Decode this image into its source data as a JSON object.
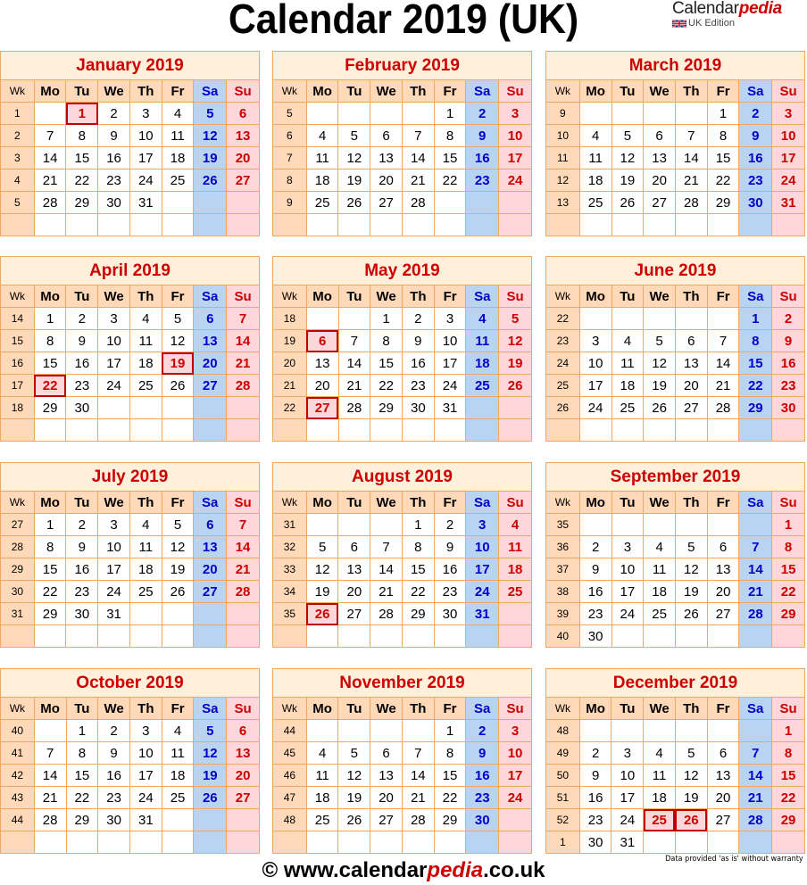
{
  "header": {
    "title": "Calendar 2019 (UK)",
    "brand": {
      "name_plain": "Calendar",
      "name_accent": "pedia",
      "edition": "UK Edition",
      "flag_icon": "uk-flag-icon"
    }
  },
  "colors": {
    "border": "#f0a860",
    "title_bg": "#fff0dc",
    "header_bg": "#ffd9b8",
    "saturday_bg": "#b8d4f0",
    "saturday_text": "#0000cc",
    "sunday_bg": "#ffd6d9",
    "sunday_text": "#cc0000",
    "holiday_border": "#c00000",
    "month_title": "#cc0000"
  },
  "weekday_headers": [
    "Wk",
    "Mo",
    "Tu",
    "We",
    "Th",
    "Fr",
    "Sa",
    "Su"
  ],
  "months": [
    {
      "name": "January 2019",
      "rows": [
        {
          "wk": "1",
          "days": [
            "",
            "1",
            "2",
            "3",
            "4",
            "5",
            "6"
          ]
        },
        {
          "wk": "2",
          "days": [
            "7",
            "8",
            "9",
            "10",
            "11",
            "12",
            "13"
          ]
        },
        {
          "wk": "3",
          "days": [
            "14",
            "15",
            "16",
            "17",
            "18",
            "19",
            "20"
          ]
        },
        {
          "wk": "4",
          "days": [
            "21",
            "22",
            "23",
            "24",
            "25",
            "26",
            "27"
          ]
        },
        {
          "wk": "5",
          "days": [
            "28",
            "29",
            "30",
            "31",
            "",
            "",
            ""
          ]
        },
        {
          "wk": "",
          "days": [
            "",
            "",
            "",
            "",
            "",
            "",
            ""
          ]
        }
      ],
      "holidays": [
        "1"
      ]
    },
    {
      "name": "February 2019",
      "rows": [
        {
          "wk": "5",
          "days": [
            "",
            "",
            "",
            "",
            "1",
            "2",
            "3"
          ]
        },
        {
          "wk": "6",
          "days": [
            "4",
            "5",
            "6",
            "7",
            "8",
            "9",
            "10"
          ]
        },
        {
          "wk": "7",
          "days": [
            "11",
            "12",
            "13",
            "14",
            "15",
            "16",
            "17"
          ]
        },
        {
          "wk": "8",
          "days": [
            "18",
            "19",
            "20",
            "21",
            "22",
            "23",
            "24"
          ]
        },
        {
          "wk": "9",
          "days": [
            "25",
            "26",
            "27",
            "28",
            "",
            "",
            ""
          ]
        },
        {
          "wk": "",
          "days": [
            "",
            "",
            "",
            "",
            "",
            "",
            ""
          ]
        }
      ],
      "holidays": []
    },
    {
      "name": "March 2019",
      "rows": [
        {
          "wk": "9",
          "days": [
            "",
            "",
            "",
            "",
            "1",
            "2",
            "3"
          ]
        },
        {
          "wk": "10",
          "days": [
            "4",
            "5",
            "6",
            "7",
            "8",
            "9",
            "10"
          ]
        },
        {
          "wk": "11",
          "days": [
            "11",
            "12",
            "13",
            "14",
            "15",
            "16",
            "17"
          ]
        },
        {
          "wk": "12",
          "days": [
            "18",
            "19",
            "20",
            "21",
            "22",
            "23",
            "24"
          ]
        },
        {
          "wk": "13",
          "days": [
            "25",
            "26",
            "27",
            "28",
            "29",
            "30",
            "31"
          ]
        },
        {
          "wk": "",
          "days": [
            "",
            "",
            "",
            "",
            "",
            "",
            ""
          ]
        }
      ],
      "holidays": []
    },
    {
      "name": "April 2019",
      "rows": [
        {
          "wk": "14",
          "days": [
            "1",
            "2",
            "3",
            "4",
            "5",
            "6",
            "7"
          ]
        },
        {
          "wk": "15",
          "days": [
            "8",
            "9",
            "10",
            "11",
            "12",
            "13",
            "14"
          ]
        },
        {
          "wk": "16",
          "days": [
            "15",
            "16",
            "17",
            "18",
            "19",
            "20",
            "21"
          ]
        },
        {
          "wk": "17",
          "days": [
            "22",
            "23",
            "24",
            "25",
            "26",
            "27",
            "28"
          ]
        },
        {
          "wk": "18",
          "days": [
            "29",
            "30",
            "",
            "",
            "",
            "",
            ""
          ]
        },
        {
          "wk": "",
          "days": [
            "",
            "",
            "",
            "",
            "",
            "",
            ""
          ]
        }
      ],
      "holidays": [
        "19",
        "22"
      ]
    },
    {
      "name": "May 2019",
      "rows": [
        {
          "wk": "18",
          "days": [
            "",
            "",
            "1",
            "2",
            "3",
            "4",
            "5"
          ]
        },
        {
          "wk": "19",
          "days": [
            "6",
            "7",
            "8",
            "9",
            "10",
            "11",
            "12"
          ]
        },
        {
          "wk": "20",
          "days": [
            "13",
            "14",
            "15",
            "16",
            "17",
            "18",
            "19"
          ]
        },
        {
          "wk": "21",
          "days": [
            "20",
            "21",
            "22",
            "23",
            "24",
            "25",
            "26"
          ]
        },
        {
          "wk": "22",
          "days": [
            "27",
            "28",
            "29",
            "30",
            "31",
            "",
            ""
          ]
        },
        {
          "wk": "",
          "days": [
            "",
            "",
            "",
            "",
            "",
            "",
            ""
          ]
        }
      ],
      "holidays": [
        "6",
        "27"
      ]
    },
    {
      "name": "June 2019",
      "rows": [
        {
          "wk": "22",
          "days": [
            "",
            "",
            "",
            "",
            "",
            "1",
            "2"
          ]
        },
        {
          "wk": "23",
          "days": [
            "3",
            "4",
            "5",
            "6",
            "7",
            "8",
            "9"
          ]
        },
        {
          "wk": "24",
          "days": [
            "10",
            "11",
            "12",
            "13",
            "14",
            "15",
            "16"
          ]
        },
        {
          "wk": "25",
          "days": [
            "17",
            "18",
            "19",
            "20",
            "21",
            "22",
            "23"
          ]
        },
        {
          "wk": "26",
          "days": [
            "24",
            "25",
            "26",
            "27",
            "28",
            "29",
            "30"
          ]
        },
        {
          "wk": "",
          "days": [
            "",
            "",
            "",
            "",
            "",
            "",
            ""
          ]
        }
      ],
      "holidays": []
    },
    {
      "name": "July 2019",
      "rows": [
        {
          "wk": "27",
          "days": [
            "1",
            "2",
            "3",
            "4",
            "5",
            "6",
            "7"
          ]
        },
        {
          "wk": "28",
          "days": [
            "8",
            "9",
            "10",
            "11",
            "12",
            "13",
            "14"
          ]
        },
        {
          "wk": "29",
          "days": [
            "15",
            "16",
            "17",
            "18",
            "19",
            "20",
            "21"
          ]
        },
        {
          "wk": "30",
          "days": [
            "22",
            "23",
            "24",
            "25",
            "26",
            "27",
            "28"
          ]
        },
        {
          "wk": "31",
          "days": [
            "29",
            "30",
            "31",
            "",
            "",
            "",
            ""
          ]
        },
        {
          "wk": "",
          "days": [
            "",
            "",
            "",
            "",
            "",
            "",
            ""
          ]
        }
      ],
      "holidays": []
    },
    {
      "name": "August 2019",
      "rows": [
        {
          "wk": "31",
          "days": [
            "",
            "",
            "",
            "1",
            "2",
            "3",
            "4"
          ]
        },
        {
          "wk": "32",
          "days": [
            "5",
            "6",
            "7",
            "8",
            "9",
            "10",
            "11"
          ]
        },
        {
          "wk": "33",
          "days": [
            "12",
            "13",
            "14",
            "15",
            "16",
            "17",
            "18"
          ]
        },
        {
          "wk": "34",
          "days": [
            "19",
            "20",
            "21",
            "22",
            "23",
            "24",
            "25"
          ]
        },
        {
          "wk": "35",
          "days": [
            "26",
            "27",
            "28",
            "29",
            "30",
            "31",
            ""
          ]
        },
        {
          "wk": "",
          "days": [
            "",
            "",
            "",
            "",
            "",
            "",
            ""
          ]
        }
      ],
      "holidays": [
        "26"
      ]
    },
    {
      "name": "September 2019",
      "rows": [
        {
          "wk": "35",
          "days": [
            "",
            "",
            "",
            "",
            "",
            "",
            "1"
          ]
        },
        {
          "wk": "36",
          "days": [
            "2",
            "3",
            "4",
            "5",
            "6",
            "7",
            "8"
          ]
        },
        {
          "wk": "37",
          "days": [
            "9",
            "10",
            "11",
            "12",
            "13",
            "14",
            "15"
          ]
        },
        {
          "wk": "38",
          "days": [
            "16",
            "17",
            "18",
            "19",
            "20",
            "21",
            "22"
          ]
        },
        {
          "wk": "39",
          "days": [
            "23",
            "24",
            "25",
            "26",
            "27",
            "28",
            "29"
          ]
        },
        {
          "wk": "40",
          "days": [
            "30",
            "",
            "",
            "",
            "",
            "",
            ""
          ]
        }
      ],
      "holidays": []
    },
    {
      "name": "October 2019",
      "rows": [
        {
          "wk": "40",
          "days": [
            "",
            "1",
            "2",
            "3",
            "4",
            "5",
            "6"
          ]
        },
        {
          "wk": "41",
          "days": [
            "7",
            "8",
            "9",
            "10",
            "11",
            "12",
            "13"
          ]
        },
        {
          "wk": "42",
          "days": [
            "14",
            "15",
            "16",
            "17",
            "18",
            "19",
            "20"
          ]
        },
        {
          "wk": "43",
          "days": [
            "21",
            "22",
            "23",
            "24",
            "25",
            "26",
            "27"
          ]
        },
        {
          "wk": "44",
          "days": [
            "28",
            "29",
            "30",
            "31",
            "",
            "",
            ""
          ]
        },
        {
          "wk": "",
          "days": [
            "",
            "",
            "",
            "",
            "",
            "",
            ""
          ]
        }
      ],
      "holidays": []
    },
    {
      "name": "November 2019",
      "rows": [
        {
          "wk": "44",
          "days": [
            "",
            "",
            "",
            "",
            "1",
            "2",
            "3"
          ]
        },
        {
          "wk": "45",
          "days": [
            "4",
            "5",
            "6",
            "7",
            "8",
            "9",
            "10"
          ]
        },
        {
          "wk": "46",
          "days": [
            "11",
            "12",
            "13",
            "14",
            "15",
            "16",
            "17"
          ]
        },
        {
          "wk": "47",
          "days": [
            "18",
            "19",
            "20",
            "21",
            "22",
            "23",
            "24"
          ]
        },
        {
          "wk": "48",
          "days": [
            "25",
            "26",
            "27",
            "28",
            "29",
            "30",
            ""
          ]
        },
        {
          "wk": "",
          "days": [
            "",
            "",
            "",
            "",
            "",
            "",
            ""
          ]
        }
      ],
      "holidays": []
    },
    {
      "name": "December 2019",
      "rows": [
        {
          "wk": "48",
          "days": [
            "",
            "",
            "",
            "",
            "",
            "",
            "1"
          ]
        },
        {
          "wk": "49",
          "days": [
            "2",
            "3",
            "4",
            "5",
            "6",
            "7",
            "8"
          ]
        },
        {
          "wk": "50",
          "days": [
            "9",
            "10",
            "11",
            "12",
            "13",
            "14",
            "15"
          ]
        },
        {
          "wk": "51",
          "days": [
            "16",
            "17",
            "18",
            "19",
            "20",
            "21",
            "22"
          ]
        },
        {
          "wk": "52",
          "days": [
            "23",
            "24",
            "25",
            "26",
            "27",
            "28",
            "29"
          ]
        },
        {
          "wk": "1",
          "days": [
            "30",
            "31",
            "",
            "",
            "",
            "",
            ""
          ]
        }
      ],
      "holidays": [
        "25",
        "26"
      ]
    }
  ],
  "footer": {
    "copyright": "© www.calendar",
    "accent": "pedia",
    "suffix": ".co.uk",
    "disclaimer": "Data provided 'as is' without warranty"
  }
}
